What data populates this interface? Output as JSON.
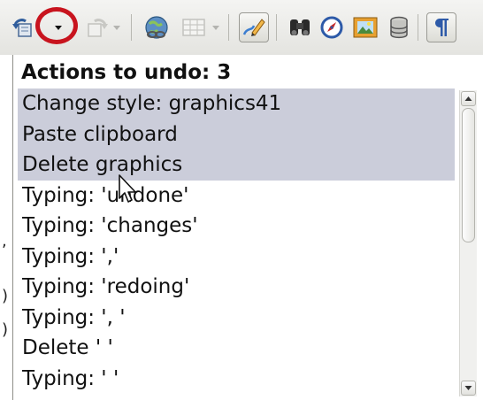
{
  "toolbar": {
    "buttons": [
      {
        "name": "undo-icon",
        "state": "enabled"
      },
      {
        "name": "undo-dropdown-arrow",
        "state": "enabled"
      },
      {
        "name": "redo-icon",
        "state": "disabled"
      },
      {
        "name": "redo-dropdown-arrow",
        "state": "disabled"
      },
      {
        "name": "hyperlink-icon"
      },
      {
        "name": "table-icon",
        "state": "disabled"
      },
      {
        "name": "table-dropdown-arrow",
        "state": "disabled"
      },
      {
        "name": "draw-functions-icon",
        "state": "active"
      },
      {
        "name": "find-replace-binoculars-icon"
      },
      {
        "name": "navigator-compass-icon"
      },
      {
        "name": "gallery-icon"
      },
      {
        "name": "data-sources-icon"
      },
      {
        "name": "formatting-marks-icon",
        "state": "active"
      }
    ]
  },
  "popup": {
    "header": "Actions to undo: 3",
    "items": [
      {
        "label": "Change style: graphics41",
        "selected": true
      },
      {
        "label": "Paste clipboard",
        "selected": true
      },
      {
        "label": "Delete graphics",
        "selected": true
      },
      {
        "label": "Typing: 'undone'",
        "selected": false
      },
      {
        "label": "Typing: 'changes'",
        "selected": false
      },
      {
        "label": "Typing: ','",
        "selected": false
      },
      {
        "label": "Typing: 'redoing'",
        "selected": false
      },
      {
        "label": "Typing: ', '",
        "selected": false
      },
      {
        "label": "Delete ' '",
        "selected": false
      },
      {
        "label": "Typing: ' '",
        "selected": false
      }
    ]
  },
  "colors": {
    "selection": "#cbcdda",
    "highlight_circle": "#c8141e",
    "toolbar_bg": "#ececea"
  }
}
